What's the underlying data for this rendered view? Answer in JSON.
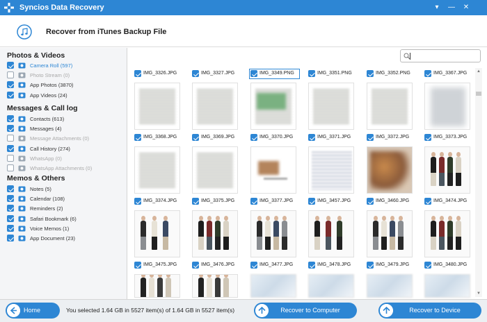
{
  "window": {
    "title": "Syncios Data Recovery",
    "controls": [
      "▾",
      "—",
      "✕"
    ]
  },
  "header": {
    "title": "Recover from iTunes Backup File"
  },
  "sidebar": {
    "categories": [
      {
        "title": "Photos & Videos",
        "items": [
          {
            "label": "Camera Roll (597)",
            "checked": true,
            "dim": false,
            "active": true,
            "icon": "camera-icon"
          },
          {
            "label": "Photo Stream (0)",
            "checked": false,
            "dim": true,
            "active": false,
            "icon": "photo-stream-icon"
          },
          {
            "label": "App Photos (3870)",
            "checked": true,
            "dim": false,
            "active": false,
            "icon": "image-icon"
          },
          {
            "label": "App Videos (24)",
            "checked": true,
            "dim": false,
            "active": false,
            "icon": "video-icon"
          }
        ]
      },
      {
        "title": "Messages & Call log",
        "items": [
          {
            "label": "Contacts (613)",
            "checked": true,
            "dim": false,
            "active": false,
            "icon": "contacts-icon"
          },
          {
            "label": "Messages (4)",
            "checked": true,
            "dim": false,
            "active": false,
            "icon": "messages-icon"
          },
          {
            "label": "Message Attachments (0)",
            "checked": false,
            "dim": true,
            "active": false,
            "icon": "attachment-icon"
          },
          {
            "label": "Call History (274)",
            "checked": true,
            "dim": false,
            "active": false,
            "icon": "phone-icon"
          },
          {
            "label": "WhatsApp (0)",
            "checked": false,
            "dim": true,
            "active": false,
            "icon": "whatsapp-icon"
          },
          {
            "label": "WhatsApp Attachments (0)",
            "checked": false,
            "dim": true,
            "active": false,
            "icon": "whatsapp-attachment-icon"
          }
        ]
      },
      {
        "title": "Memos & Others",
        "items": [
          {
            "label": "Notes (5)",
            "checked": true,
            "dim": false,
            "active": false,
            "icon": "notes-icon"
          },
          {
            "label": "Calendar (108)",
            "checked": true,
            "dim": false,
            "active": false,
            "icon": "calendar-icon"
          },
          {
            "label": "Reminders (2)",
            "checked": true,
            "dim": false,
            "active": false,
            "icon": "reminders-icon"
          },
          {
            "label": "Safari Bookmark (6)",
            "checked": true,
            "dim": false,
            "active": false,
            "icon": "bookmark-icon"
          },
          {
            "label": "Voice Memos (1)",
            "checked": true,
            "dim": false,
            "active": false,
            "icon": "microphone-icon"
          },
          {
            "label": "App Document (23)",
            "checked": true,
            "dim": false,
            "active": false,
            "icon": "document-icon"
          }
        ]
      }
    ]
  },
  "photos": [
    {
      "name": "IMG_3326.JPG",
      "kind": "doc"
    },
    {
      "name": "IMG_3327.JPG",
      "kind": "doc"
    },
    {
      "name": "IMG_3349.PNG",
      "kind": "doc-green"
    },
    {
      "name": "IMG_3351.PNG",
      "kind": "doc"
    },
    {
      "name": "IMG_3352.PNG",
      "kind": "doc"
    },
    {
      "name": "IMG_3367.JPG",
      "kind": "blurred"
    },
    {
      "name": "IMG_3368.JPG",
      "kind": "doc"
    },
    {
      "name": "IMG_3369.JPG",
      "kind": "doc"
    },
    {
      "name": "IMG_3370.JPG",
      "kind": "product"
    },
    {
      "name": "IMG_3371.JPG",
      "kind": "paper"
    },
    {
      "name": "IMG_3372.JPG",
      "kind": "orange"
    },
    {
      "name": "IMG_3373.JPG",
      "kind": "fashion"
    },
    {
      "name": "IMG_3374.JPG",
      "kind": "fashion"
    },
    {
      "name": "IMG_3375.JPG",
      "kind": "fashion"
    },
    {
      "name": "IMG_3377.JPG",
      "kind": "fashion"
    },
    {
      "name": "IMG_3457.JPG",
      "kind": "fashion"
    },
    {
      "name": "IMG_3460.JPG",
      "kind": "fashion"
    },
    {
      "name": "IMG_3474.JPG",
      "kind": "fashion"
    },
    {
      "name": "IMG_3475.JPG",
      "kind": "fashion"
    },
    {
      "name": "IMG_3476.JPG",
      "kind": "fashion"
    },
    {
      "name": "IMG_3477.JPG",
      "kind": "photo-blur"
    },
    {
      "name": "IMG_3478.JPG",
      "kind": "photo-blur"
    },
    {
      "name": "IMG_3479.JPG",
      "kind": "photo-blur"
    },
    {
      "name": "IMG_3480.JPG",
      "kind": "photo-blur"
    }
  ],
  "selected_photo": "IMG_3349.PNG",
  "footer": {
    "home_label": "Home",
    "status": "You selected 1.64 GB in 5527 item(s) of 1.64 GB in 5527 item(s)",
    "recover_computer_label": "Recover to Computer",
    "recover_device_label": "Recover to Device"
  },
  "colors": {
    "accent": "#2d86d4",
    "active_item": "#2d86d4"
  }
}
